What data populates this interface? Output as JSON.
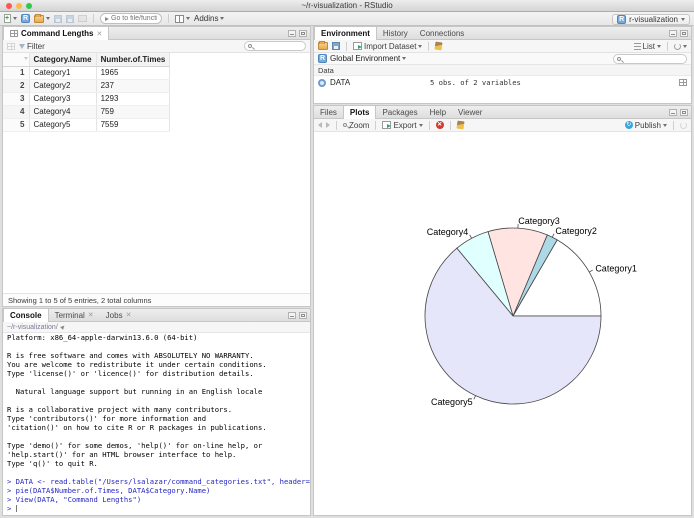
{
  "window": {
    "title": "~/r-visualization - RStudio",
    "project": "r-visualization"
  },
  "toolbar": {
    "goto_placeholder": "Go to file/function",
    "addins": "Addins"
  },
  "viewer": {
    "tab": "Command Lengths",
    "filter": "Filter",
    "columns": [
      "Category.Name",
      "Number.of.Times"
    ],
    "rows": [
      {
        "n": "1",
        "name": "Category1",
        "times": "1965"
      },
      {
        "n": "2",
        "name": "Category2",
        "times": "237"
      },
      {
        "n": "3",
        "name": "Category3",
        "times": "1293"
      },
      {
        "n": "4",
        "name": "Category4",
        "times": "759"
      },
      {
        "n": "5",
        "name": "Category5",
        "times": "7559"
      }
    ],
    "footer": "Showing 1 to 5 of 5 entries, 2 total columns"
  },
  "environment": {
    "tabs": [
      "Environment",
      "History",
      "Connections"
    ],
    "import_dataset": "Import Dataset",
    "list": "List",
    "scope": "Global Environment",
    "section": "Data",
    "objects": [
      {
        "name": "DATA",
        "summary": "5 obs. of 2 variables"
      }
    ]
  },
  "plots": {
    "tabs": [
      "Files",
      "Plots",
      "Packages",
      "Help",
      "Viewer"
    ],
    "zoom": "Zoom",
    "export": "Export",
    "publish": "Publish"
  },
  "console": {
    "tabs": [
      "Console",
      "Terminal",
      "Jobs"
    ],
    "path": "~/r-visualization/",
    "lines": [
      {
        "t": "Platform: x86_64-apple-darwin13.6.0 (64-bit)",
        "c": "out"
      },
      {
        "t": " ",
        "c": "out"
      },
      {
        "t": "R is free software and comes with ABSOLUTELY NO WARRANTY.",
        "c": "out"
      },
      {
        "t": "You are welcome to redistribute it under certain conditions.",
        "c": "out"
      },
      {
        "t": "Type 'license()' or 'licence()' for distribution details.",
        "c": "out"
      },
      {
        "t": " ",
        "c": "out"
      },
      {
        "t": "  Natural language support but running in an English locale",
        "c": "out"
      },
      {
        "t": " ",
        "c": "out"
      },
      {
        "t": "R is a collaborative project with many contributors.",
        "c": "out"
      },
      {
        "t": "Type 'contributors()' for more information and",
        "c": "out"
      },
      {
        "t": "'citation()' on how to cite R or R packages in publications.",
        "c": "out"
      },
      {
        "t": " ",
        "c": "out"
      },
      {
        "t": "Type 'demo()' for some demos, 'help()' for on-line help, or",
        "c": "out"
      },
      {
        "t": "'help.start()' for an HTML browser interface to help.",
        "c": "out"
      },
      {
        "t": "Type 'q()' to quit R.",
        "c": "out"
      },
      {
        "t": " ",
        "c": "out"
      },
      {
        "t": "> DATA <- read.table(\"/Users/lsalazar/command_categories.txt\", header=TRUE)",
        "c": "cmd"
      },
      {
        "t": "> pie(DATA$Number.of.Times, DATA$Category.Name)",
        "c": "cmd"
      },
      {
        "t": "> View(DATA, \"Command Lengths\")",
        "c": "cmd"
      }
    ],
    "prompt": "> "
  },
  "chart_data": {
    "type": "pie",
    "categories": [
      "Category1",
      "Category2",
      "Category3",
      "Category4",
      "Category5"
    ],
    "values": [
      1965,
      237,
      1293,
      759,
      7559
    ],
    "colors": [
      "#FFFFFF",
      "#ADD8E6",
      "#FFE4E1",
      "#E0FFFF",
      "#E6E6FA"
    ],
    "stroke": "#454545",
    "start_angle_deg": 0,
    "direction": "counterclockwise",
    "center": [
      199,
      183
    ],
    "radius": 88
  }
}
